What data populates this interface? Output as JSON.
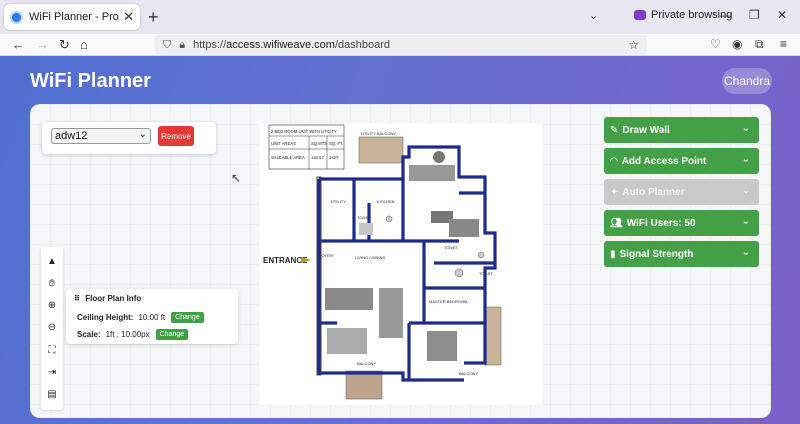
{
  "browser": {
    "tab_title": "WiFi Planner - Professional WiFi",
    "private_label": "Private browsing",
    "url_prefix": "https://",
    "url_host": "access.wifiweave.com",
    "url_path": "/dashboard"
  },
  "app": {
    "title": "WiFi Planner",
    "user_name": "Chandra"
  },
  "floor_selector": {
    "selected": "adw12",
    "remove_label": "Remove"
  },
  "tools": [
    "select-icon",
    "hand-icon",
    "zoom-in-icon",
    "zoom-out-icon",
    "fit-screen-icon",
    "export-icon",
    "document-icon"
  ],
  "floor_info": {
    "title": "Floor Plan Info",
    "ceiling_label": "Ceiling Height:",
    "ceiling_value": "10.00 ft",
    "scale_label": "Scale:",
    "scale_value": "1ft : 10.00px",
    "change_label": "Change"
  },
  "floor_plan": {
    "table_title": "2 BED ROOM UNIT WITH UTILITY",
    "table_col1": "UNIT AREAS",
    "table_col2": "SQ.MTS",
    "table_col3": "SQ. FT.",
    "table_row_label": "SALEABLE AREA",
    "table_sqm": "132.57",
    "table_sqft": "1427",
    "entrance_label": "ENTRANCE",
    "rooms": [
      "UTILITY BALCONY",
      "UTILITY",
      "TOILET",
      "KITCHEN",
      "FOYER",
      "LIVING / DINING",
      "TOILET",
      "MASTER BEDROOM",
      "BALCONY",
      "BALCONY",
      "TOILET"
    ]
  },
  "right_panels": [
    {
      "label": "Draw Wall",
      "icon": "pencil-icon",
      "enabled": true
    },
    {
      "label": "Add Access Point",
      "icon": "wifi-icon",
      "enabled": true
    },
    {
      "label": "Auto Planner",
      "icon": "magic-icon",
      "enabled": false
    },
    {
      "label": "WiFi Users: 50",
      "icon": "users-icon",
      "enabled": true
    },
    {
      "label": "Signal Strength",
      "icon": "signal-icon",
      "enabled": true
    }
  ],
  "colors": {
    "accent_green": "#43a047",
    "remove_red": "#e53935",
    "disabled_gray": "#c9c9c9",
    "header_gradient_start": "#4f6fd1",
    "header_gradient_end": "#7b5fc8",
    "wall_blue": "#1e2a8c"
  }
}
